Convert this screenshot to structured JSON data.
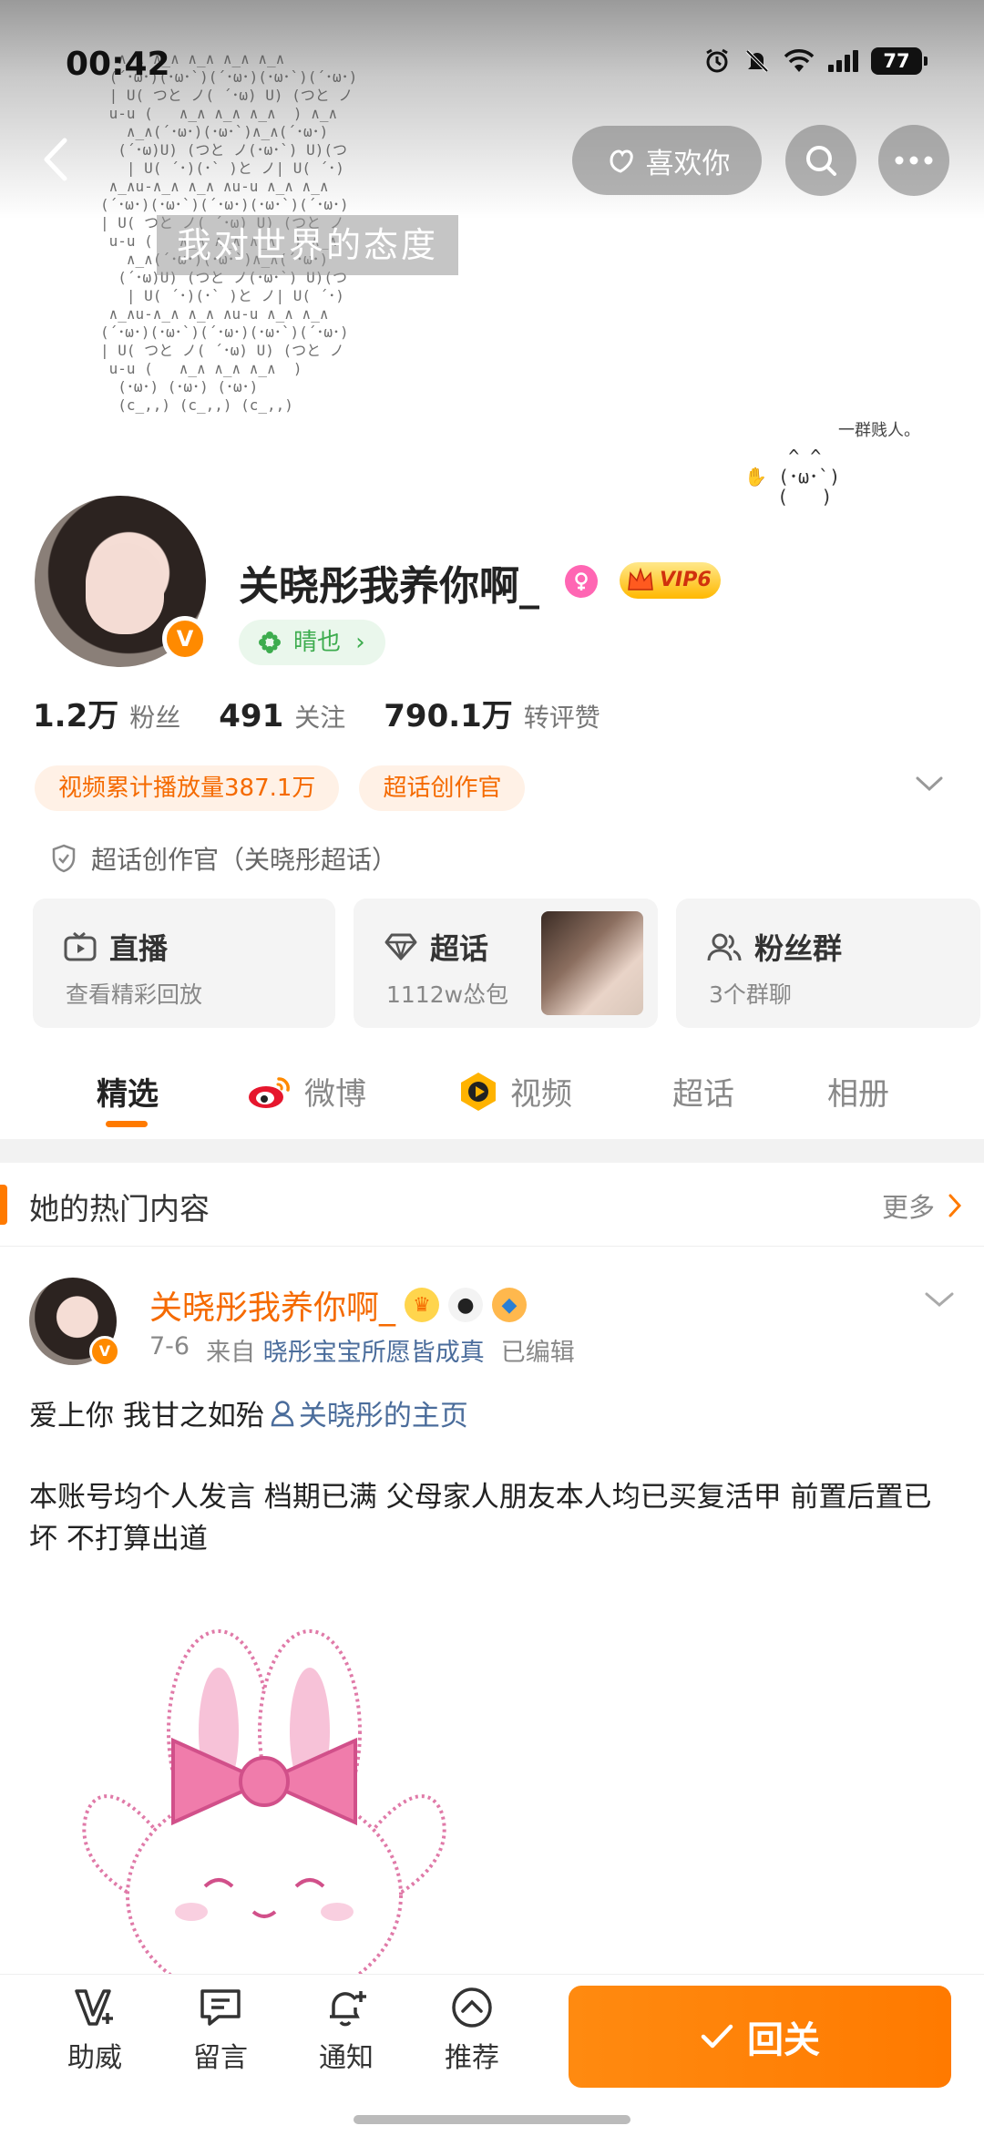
{
  "status_bar": {
    "time": "00:42",
    "battery": "77"
  },
  "cover": {
    "caption": "我对世界的态度",
    "side_note": "一群贱人。"
  },
  "top_nav": {
    "like_label": "喜欢你"
  },
  "profile": {
    "username": "关晓彤我养你啊_",
    "verified_badge": "V",
    "vip_label": "VIP6",
    "tag": "晴也",
    "stats": [
      {
        "num": "1.2万",
        "label": "粉丝"
      },
      {
        "num": "491",
        "label": "关注"
      },
      {
        "num": "790.1万",
        "label": "转评赞"
      }
    ],
    "badges": [
      "视频累计播放量387.1万",
      "超话创作官"
    ],
    "certification": "超话创作官（关晓彤超话）"
  },
  "cards": [
    {
      "title": "直播",
      "sub": "查看精彩回放"
    },
    {
      "title": "超话",
      "sub": "1112w怂包"
    },
    {
      "title": "粉丝群",
      "sub": "3个群聊"
    }
  ],
  "tabs": [
    "精选",
    "微博",
    "视频",
    "超话",
    "相册"
  ],
  "hot_section": {
    "title": "她的热门内容",
    "more": "更多"
  },
  "post": {
    "author": "关晓彤我养你啊_",
    "date": "7-6",
    "source_prefix": "来自",
    "source": "晓彤宝宝所愿皆成真",
    "edited": "已编辑",
    "text_line1": "爱上你 我甘之如殆",
    "link_text": "关晓彤的主页",
    "text_body": "本账号均个人发言 档期已满 父母家人朋友本人均已买复活甲 前置后置已坏  不打算出道"
  },
  "bottom_bar": {
    "items": [
      "助威",
      "留言",
      "通知",
      "推荐"
    ],
    "follow_label": "回关"
  },
  "colors": {
    "accent": "#ff7a00",
    "link": "#4a6c9b",
    "green_tag": "#3dac4e"
  }
}
